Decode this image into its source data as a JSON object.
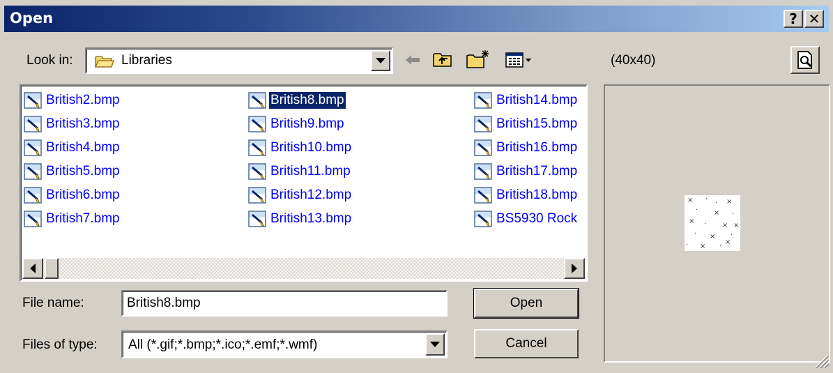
{
  "window": {
    "title": "Open",
    "help_label": "?",
    "close_label": "✕"
  },
  "look_in": {
    "label": "Look in:",
    "value": "Libraries"
  },
  "toolbar": {
    "back_icon": "arrow-left-icon",
    "up_icon": "folder-up-icon",
    "new_folder_icon": "new-folder-icon",
    "view_menu_icon": "view-menu-icon"
  },
  "preview": {
    "size_label": "(40x40)",
    "toggle_icon": "preview-page-icon"
  },
  "files": {
    "columns": [
      [
        "British2.bmp",
        "British3.bmp",
        "British4.bmp",
        "British5.bmp",
        "British6.bmp",
        "British7.bmp"
      ],
      [
        "British8.bmp",
        "British9.bmp",
        "British10.bmp",
        "British11.bmp",
        "British12.bmp",
        "British13.bmp"
      ],
      [
        "British14.bmp",
        "British15.bmp",
        "British16.bmp",
        "British17.bmp",
        "British18.bmp",
        "BS5930 Rock"
      ]
    ],
    "selected": "British8.bmp"
  },
  "file_name": {
    "label": "File name:",
    "value": "British8.bmp"
  },
  "file_type": {
    "label": "Files of type:",
    "value": "All (*.gif;*.bmp;*.ico;*.emf;*.wmf)"
  },
  "buttons": {
    "open": "Open",
    "cancel": "Cancel"
  },
  "colors": {
    "title_start": "#0a246a",
    "title_end": "#a6caf0",
    "file_text": "#0000ff",
    "selection": "#0a246a",
    "face": "#d4d0c8"
  }
}
